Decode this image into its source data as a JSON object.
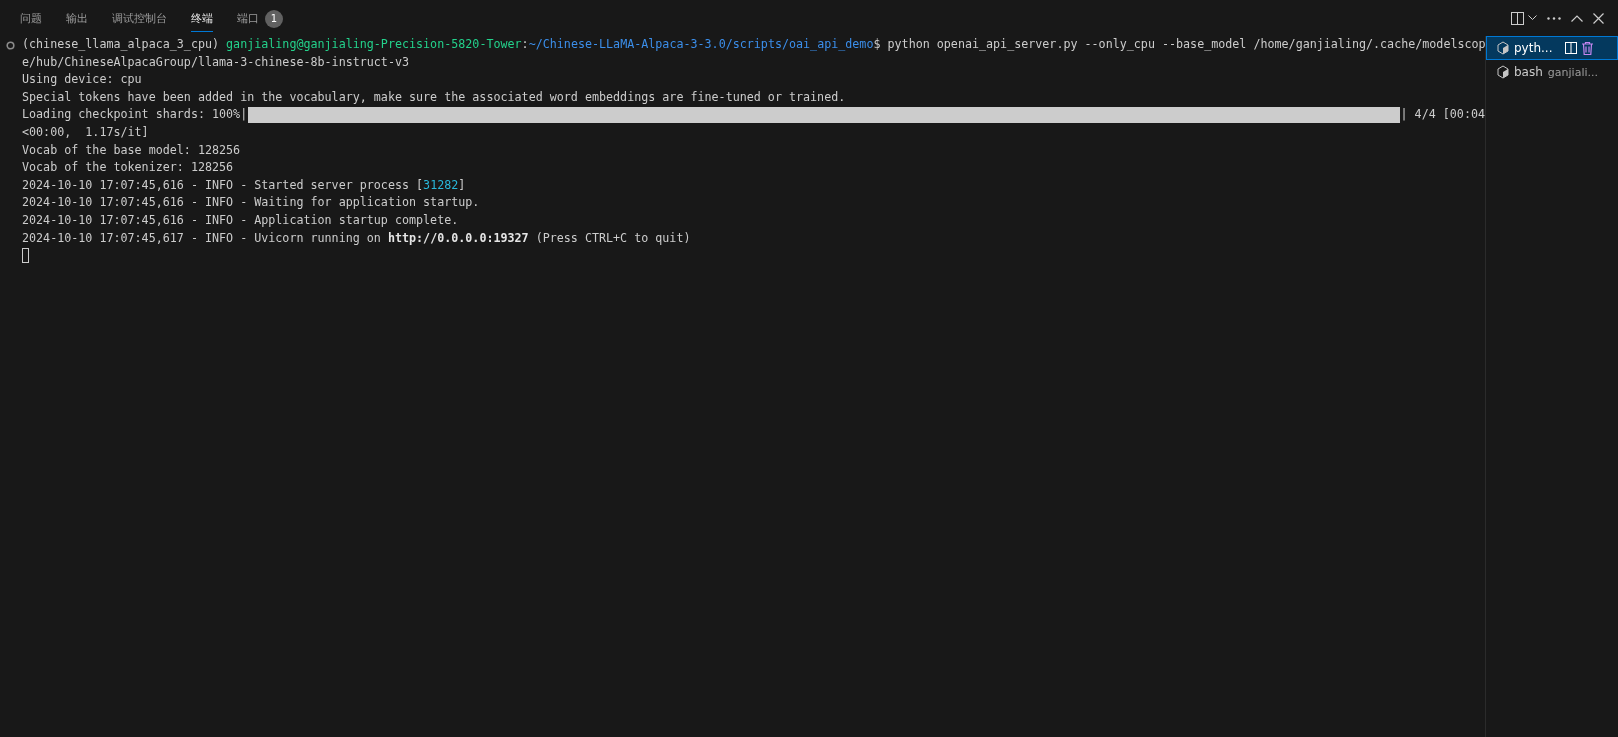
{
  "tabs": [
    {
      "label": "问题",
      "selected": false
    },
    {
      "label": "输出",
      "selected": false
    },
    {
      "label": "调试控制台",
      "selected": false
    },
    {
      "label": "终端",
      "selected": true
    },
    {
      "label": "端口",
      "selected": false,
      "badge": "1"
    }
  ],
  "terminal": {
    "lines": [
      {
        "kind": "command",
        "segments": [
          {
            "kind": "text",
            "text": "(chinese_llama_alpaca_3_cpu) "
          },
          {
            "kind": "user_host",
            "text": "ganjialing@ganjialing-Precision-5820-Tower"
          },
          {
            "kind": "text",
            "text": ":"
          },
          {
            "kind": "path",
            "text": "~/Chinese-LLaMA-Alpaca-3-3.0/scripts/oai_api_demo"
          },
          {
            "kind": "text",
            "text": "$ python openai_api_server.py --only_cpu --base_model /home/ganjialing/.cache/modelscop"
          }
        ]
      },
      {
        "kind": "text",
        "segments": [
          {
            "kind": "text",
            "text": "e/hub/ChineseAlpacaGroup/llama-3-chinese-8b-instruct-v3"
          }
        ]
      },
      {
        "kind": "text",
        "segments": [
          {
            "kind": "text",
            "text": "Using device: cpu"
          }
        ]
      },
      {
        "kind": "text",
        "segments": [
          {
            "kind": "text",
            "text": "Special tokens have been added in the vocabulary, make sure the associated word embeddings are fine-tuned or trained."
          }
        ]
      },
      {
        "kind": "progress",
        "prefix": "Loading checkpoint shards: 100%|",
        "level": 1,
        "suffix": "| 4/4 [00:04"
      },
      {
        "kind": "text",
        "segments": [
          {
            "kind": "text",
            "text": "<00:00,  1.17s/it]"
          }
        ]
      },
      {
        "kind": "text",
        "segments": [
          {
            "kind": "text",
            "text": "Vocab of the base model: 128256"
          }
        ]
      },
      {
        "kind": "text",
        "segments": [
          {
            "kind": "text",
            "text": "Vocab of the tokenizer: 128256"
          }
        ]
      },
      {
        "kind": "text",
        "segments": [
          {
            "kind": "text",
            "text": "2024-10-10 17:07:45,616 - INFO - Started server process ["
          },
          {
            "kind": "pid",
            "text": "31282"
          },
          {
            "kind": "text",
            "text": "]"
          }
        ]
      },
      {
        "kind": "text",
        "segments": [
          {
            "kind": "text",
            "text": "2024-10-10 17:07:45,616 - INFO - Waiting for application startup."
          }
        ]
      },
      {
        "kind": "text",
        "segments": [
          {
            "kind": "text",
            "text": "2024-10-10 17:07:45,616 - INFO - Application startup complete."
          }
        ]
      },
      {
        "kind": "text",
        "segments": [
          {
            "kind": "text",
            "text": "2024-10-10 17:07:45,617 - INFO - Uvicorn running on "
          },
          {
            "kind": "url",
            "text": "http://0.0.0.0:19327"
          },
          {
            "kind": "text",
            "text": " (Press CTRL+C to quit)"
          }
        ]
      },
      {
        "kind": "cursor"
      }
    ]
  },
  "sessions": [
    {
      "name": "pyth...",
      "selected": true
    },
    {
      "name": "bash",
      "detail": "ganjiali...",
      "selected": false
    }
  ]
}
